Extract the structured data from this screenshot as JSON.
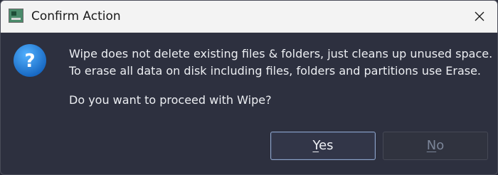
{
  "window": {
    "title": "Confirm Action",
    "close_label": "close"
  },
  "message": {
    "line1": "Wipe does not delete existing files & folders, just cleans up unused space.",
    "line2": "To erase all data on disk including files, folders and partitions use Erase.",
    "prompt": "Do you want to proceed with Wipe?"
  },
  "buttons": {
    "yes": {
      "accel": "Y",
      "rest": "es",
      "enabled": true
    },
    "no": {
      "accel": "N",
      "rest": "o",
      "enabled": false
    }
  },
  "icons": {
    "app": "app-window-icon",
    "question": "question-icon",
    "close": "close-icon"
  },
  "colors": {
    "dialog_background": "#2d303f",
    "titlebar_background": "#f3f3f3",
    "question_icon": "#1e88e5",
    "default_button_border": "#8fa4c8",
    "disabled_text": "#7b8598"
  }
}
